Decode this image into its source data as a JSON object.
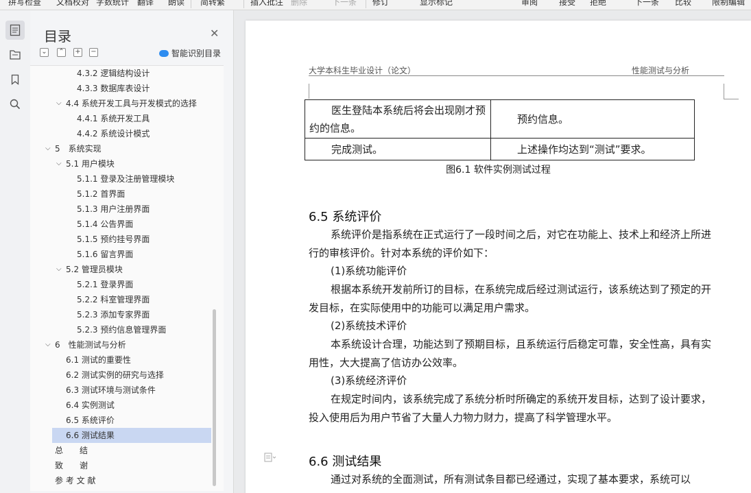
{
  "toolbar": {
    "items": [
      "拼写检查",
      "文档校对",
      "字数统计",
      "翻译",
      "朗读",
      "简转繁",
      "插入批注",
      "删除",
      "下一条",
      "修订",
      "显示标记",
      "审阅",
      "接受",
      "拒绝",
      "下一条",
      "比较",
      "限制编辑"
    ]
  },
  "toc": {
    "title": "目录",
    "smart_label": "智能识别目录",
    "items": [
      {
        "label": "4.3.2 逻辑结构设计",
        "level": 3
      },
      {
        "label": "4.3.3 数据库表设计",
        "level": 3
      },
      {
        "label": "4.4 系统开发工具与开发模式的选择",
        "level": 2,
        "expanded": true
      },
      {
        "label": "4.4.1 系统开发工具",
        "level": 3
      },
      {
        "label": "4.4.2 系统设计模式",
        "level": 3
      },
      {
        "label": "5　系统实现",
        "level": 1,
        "expanded": true
      },
      {
        "label": "5.1 用户模块",
        "level": 2,
        "expanded": true
      },
      {
        "label": "5.1.1 登录及注册管理模块",
        "level": 3
      },
      {
        "label": "5.1.2 首界面",
        "level": 3
      },
      {
        "label": "5.1.3 用户注册界面",
        "level": 3
      },
      {
        "label": "5.1.4 公告界面",
        "level": 3
      },
      {
        "label": "5.1.5 预约挂号界面",
        "level": 3
      },
      {
        "label": "5.1.6 留言界面",
        "level": 3
      },
      {
        "label": "5.2 管理员模块",
        "level": 2,
        "expanded": true
      },
      {
        "label": "5.2.1 登录界面",
        "level": 3
      },
      {
        "label": "5.2.2 科室管理界面",
        "level": 3
      },
      {
        "label": "5.2.3 添加专家界面",
        "level": 3
      },
      {
        "label": "5.2.3 预约信息管理界面",
        "level": 3
      },
      {
        "label": "6　性能测试与分析",
        "level": 1,
        "expanded": true
      },
      {
        "label": "6.1 测试的重要性",
        "level": 2
      },
      {
        "label": "6.2 测试实例的研究与选择",
        "level": 2
      },
      {
        "label": "6.3 测试环境与测试条件",
        "level": 2
      },
      {
        "label": "6.4 实例测试",
        "level": 2
      },
      {
        "label": "6.5 系统评价",
        "level": 2
      },
      {
        "label": "6.6 测试结果",
        "level": 2,
        "selected": true
      },
      {
        "label": "总　　结",
        "level": 1
      },
      {
        "label": "致　　谢",
        "level": 1
      },
      {
        "label": "参 考 文 献",
        "level": 1
      }
    ]
  },
  "document": {
    "header_left": "大学本科生毕业设计（论文）",
    "header_right": "性能测试与分析",
    "table_rows": [
      [
        "医生登陆本系统后将会出现刚才预约的信息。",
        "预约信息。"
      ],
      [
        "完成测试。",
        "上述操作均达到“测试”要求。"
      ]
    ],
    "caption": "图6.1 软件实例测试过程",
    "section_65_title": "6.5 系统评价",
    "p1": "系统评价是指系统在正式运行了一段时间之后，对它在功能上、技术上和经济上所进行的审核评价。针对本系统的评价如下：",
    "p2": "(1)系统功能评价",
    "p3": "根据本系统开发前所订的目标，在系统完成后经过测试运行，该系统达到了预定的开发目标，在实际使用中的功能可以满足用户需求。",
    "p4": "(2)系统技术评价",
    "p5": "本系统设计合理，功能达到了预期目标，且系统运行后稳定可靠，安全性高，具有实用性，大大提高了信访办公效率。",
    "p6": "(3)系统经济评价",
    "p7": "在规定时间内，该系统完成了系统分析时所确定的系统开发目标，达到了设计要求，投入使用后为用户节省了大量人力物力财力，提高了科学管理水平。",
    "section_66_title": "6.6 测试结果",
    "p8": "通过对系统的全面测试，所有测试条目都已经通过，实现了基本要求，系统可以"
  }
}
